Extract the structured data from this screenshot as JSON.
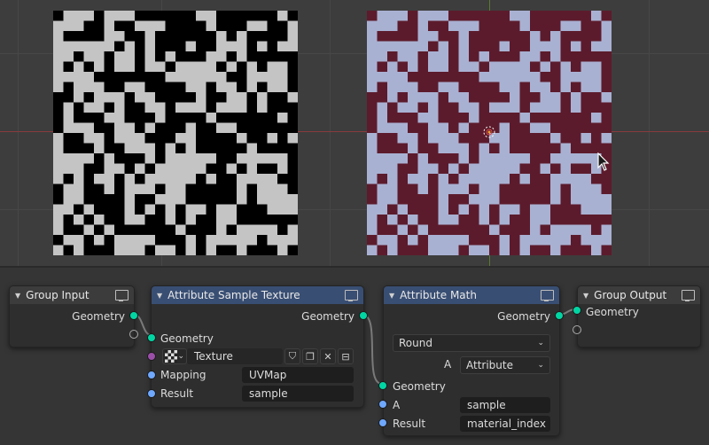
{
  "viewport": {
    "axis_x_color": "#8a3b3e",
    "axis_y_color": "#5c7a2e",
    "left_plane": {
      "color_a": "#000000",
      "color_b": "#c4c4c4"
    },
    "right_plane": {
      "color_a": "#5c1b2c",
      "color_b": "#a9b1d2"
    }
  },
  "nodes": {
    "group_input": {
      "title": "Group Input",
      "outputs": {
        "geometry": "Geometry"
      }
    },
    "attr_sample_texture": {
      "title": "Attribute Sample Texture",
      "outputs": {
        "geometry": "Geometry"
      },
      "inputs": {
        "geometry": "Geometry"
      },
      "texture_field": "Texture",
      "mapping_label": "Mapping",
      "mapping_value": "UVMap",
      "result_label": "Result",
      "result_value": "sample"
    },
    "attr_math": {
      "title": "Attribute Math",
      "outputs": {
        "geometry": "Geometry"
      },
      "operation": "Round",
      "a_label": "A",
      "a_type": "Attribute",
      "inputs": {
        "geometry": "Geometry"
      },
      "a_socket_label": "A",
      "a_value": "sample",
      "result_label": "Result",
      "result_value": "material_index"
    },
    "group_output": {
      "title": "Group Output",
      "inputs": {
        "geometry": "Geometry"
      }
    }
  },
  "colors": {
    "header_attribute": "#394e73",
    "header_group": "#3c3c3c",
    "socket_geometry": "#00d6a3",
    "socket_attribute": "#6fa8ff",
    "socket_texture": "#9b4fa9"
  },
  "icons": [
    "monitor-icon",
    "collapse-triangle-icon",
    "checker-texture-icon",
    "chevron-down-icon",
    "fake-user-shield-icon",
    "duplicate-icon",
    "close-icon",
    "browse-icon",
    "origin-icon",
    "mouse-cursor-icon"
  ]
}
